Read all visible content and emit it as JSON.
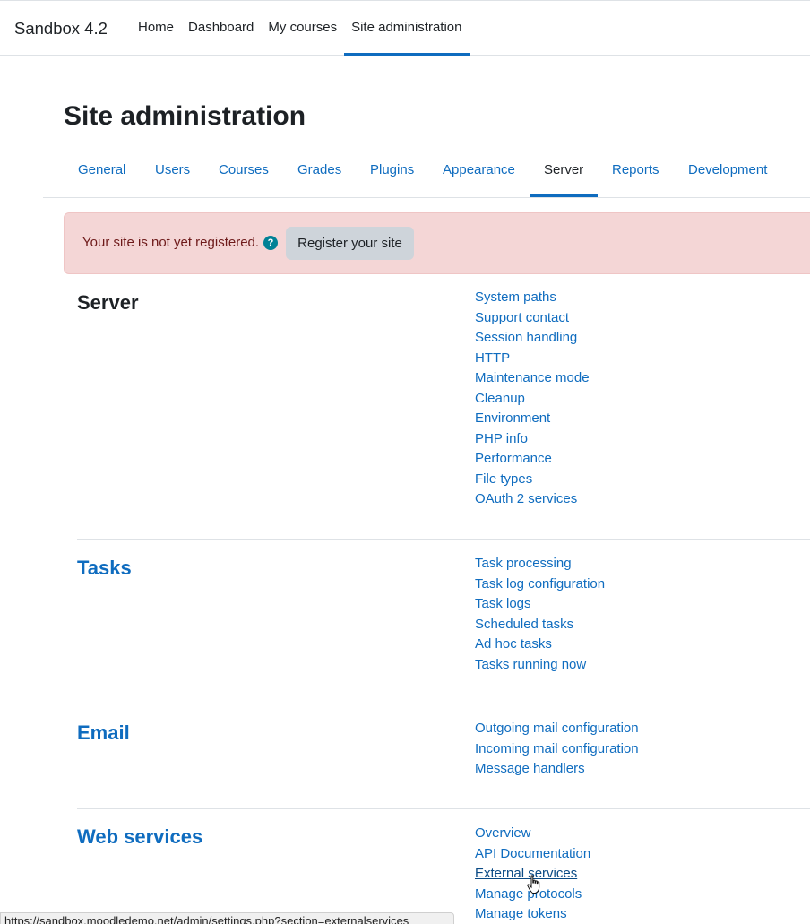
{
  "brand": "Sandbox 4.2",
  "primary_nav": [
    "Home",
    "Dashboard",
    "My courses",
    "Site administration"
  ],
  "page_title": "Site administration",
  "tabs": [
    "General",
    "Users",
    "Courses",
    "Grades",
    "Plugins",
    "Appearance",
    "Server",
    "Reports",
    "Development"
  ],
  "active_tab": "Server",
  "alert": {
    "text": "Your site is not yet registered.",
    "help_icon": "?",
    "button": "Register your site"
  },
  "sections": [
    {
      "title": "Server",
      "links": [
        "System paths",
        "Support contact",
        "Session handling",
        "HTTP",
        "Maintenance mode",
        "Cleanup",
        "Environment",
        "PHP info",
        "Performance",
        "File types",
        "OAuth 2 services"
      ]
    },
    {
      "title": "Tasks",
      "links": [
        "Task processing",
        "Task log configuration",
        "Task logs",
        "Scheduled tasks",
        "Ad hoc tasks",
        "Tasks running now"
      ]
    },
    {
      "title": "Email",
      "links": [
        "Outgoing mail configuration",
        "Incoming mail configuration",
        "Message handlers"
      ]
    },
    {
      "title": "Web services",
      "links": [
        "Overview",
        "API Documentation",
        "External services",
        "Manage protocols",
        "Manage tokens"
      ]
    }
  ],
  "hovered_link": "External services",
  "status_url": "https://sandbox.moodledemo.net/admin/settings.php?section=externalservices",
  "colors": {
    "link": "#0f6cbf",
    "alert_bg": "#f4d6d6",
    "alert_text": "#6e1a1a",
    "help_icon": "#008196"
  }
}
